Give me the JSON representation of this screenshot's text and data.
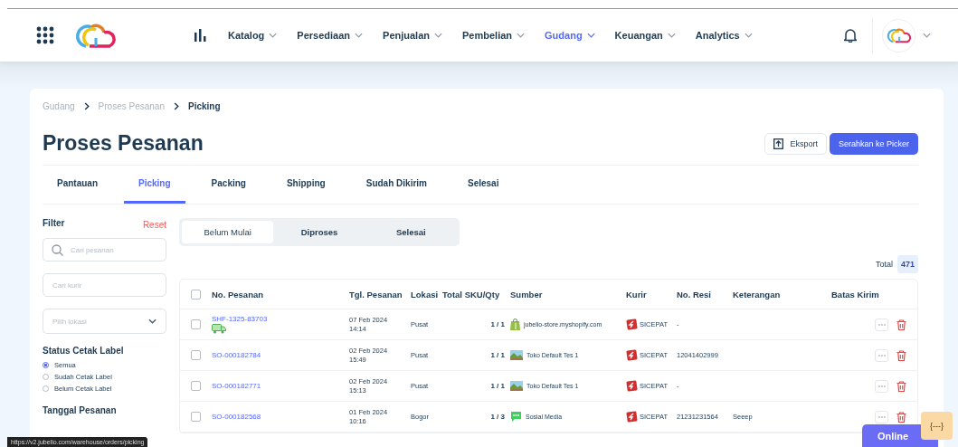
{
  "nav": {
    "items": [
      {
        "label": "Katalog",
        "selected": false
      },
      {
        "label": "Persediaan",
        "selected": false
      },
      {
        "label": "Penjualan",
        "selected": false
      },
      {
        "label": "Pembelian",
        "selected": false
      },
      {
        "label": "Gudang",
        "selected": true
      },
      {
        "label": "Keuangan",
        "selected": false
      },
      {
        "label": "Analytics",
        "selected": false
      }
    ]
  },
  "breadcrumb": [
    "Gudang",
    "Proses Pesanan",
    "Picking"
  ],
  "title": "Proses Pesanan",
  "actions": {
    "export": "Eksport",
    "primary": "Serahkan ke Picker"
  },
  "tabs": [
    {
      "label": "Pantauan",
      "selected": false
    },
    {
      "label": "Picking",
      "selected": true
    },
    {
      "label": "Packing",
      "selected": false
    },
    {
      "label": "Shipping",
      "selected": false
    },
    {
      "label": "Sudah Dikirim",
      "selected": false
    },
    {
      "label": "Selesai",
      "selected": false
    }
  ],
  "filter": {
    "title": "Filter",
    "reset": "Reset",
    "search_placeholder": "Cari pesanan",
    "courier_placeholder": "Cari kurir",
    "location_placeholder": "Pilih lokasi",
    "label_status_title": "Status Cetak Label",
    "label_status_options": [
      {
        "label": "Semua",
        "selected": true
      },
      {
        "label": "Sudah Cetak Label",
        "selected": false
      },
      {
        "label": "Belum Cetak Label",
        "selected": false
      }
    ],
    "date_title": "Tanggal Pesanan"
  },
  "segments": [
    {
      "label": "Belum Mulai",
      "selected": true
    },
    {
      "label": "Diproses",
      "selected": false
    },
    {
      "label": "Selesai",
      "selected": false
    }
  ],
  "total": {
    "label": "Total",
    "value": "471"
  },
  "table": {
    "select_all_checked": false,
    "columns": [
      "No. Pesanan",
      "Tgl. Pesanan",
      "Lokasi",
      "Total SKU/Qty",
      "Sumber",
      "Kurir",
      "No. Resi",
      "Keterangan",
      "Batas Kirim"
    ],
    "rows": [
      {
        "checked": false,
        "order": "SHF-1325-83703",
        "shipping_icon": true,
        "date": "07 Feb 2024",
        "time": "14:14",
        "location": "Pusat",
        "qty": "1 / 1",
        "kind": "shopify",
        "source": "jubelio-store.myshopify.com",
        "courier": "SICEPAT",
        "resi": "-",
        "note": ""
      },
      {
        "checked": false,
        "order": "SO-000182784",
        "shipping_icon": false,
        "date": "02 Feb 2024",
        "time": "15:49",
        "location": "Pusat",
        "qty": "1 / 1",
        "kind": "store",
        "source": "Toko Default Tes 1",
        "courier": "SICEPAT",
        "resi": "12041402999",
        "note": ""
      },
      {
        "checked": false,
        "order": "SO-000182771",
        "shipping_icon": false,
        "date": "02 Feb 2024",
        "time": "15:13",
        "location": "Pusat",
        "qty": "1 / 1",
        "kind": "store",
        "source": "Toko Default Tes 1",
        "courier": "SICEPAT",
        "resi": "-",
        "note": ""
      },
      {
        "checked": false,
        "order": "SO-000182568",
        "shipping_icon": false,
        "date": "01 Feb 2024",
        "time": "10:16",
        "location": "Bogor",
        "qty": "1 / 3",
        "kind": "chat",
        "source": "Sosial Media",
        "courier": "SICEPAT",
        "resi": "21231231564",
        "note": "Seeep"
      }
    ]
  },
  "status_url": "https://v2.jubelio.com/warehouse/orders/picking",
  "chat": {
    "label": "Online",
    "code": "{---}"
  }
}
